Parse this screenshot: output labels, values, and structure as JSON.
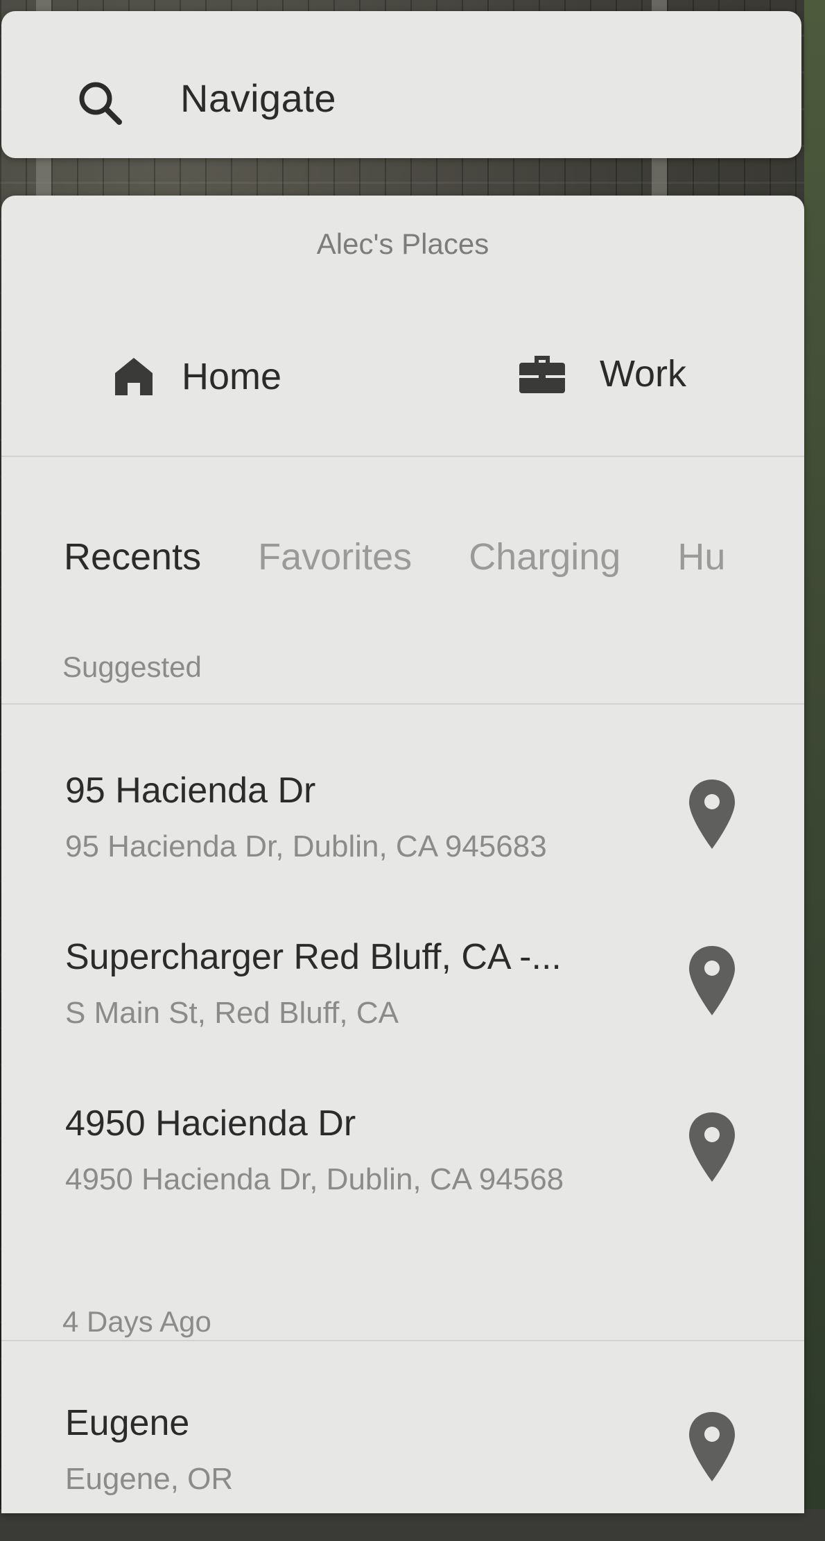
{
  "search": {
    "placeholder": "Navigate",
    "icon": "search-icon"
  },
  "places": {
    "title": "Alec's Places",
    "quick": [
      {
        "label": "Home",
        "icon": "home-icon"
      },
      {
        "label": "Work",
        "icon": "briefcase-icon"
      }
    ],
    "tabs": [
      "Recents",
      "Favorites",
      "Charging",
      "Hu"
    ],
    "active_tab": "Recents",
    "sections": [
      {
        "label": "Suggested",
        "items": [
          {
            "title": "95  Hacienda Dr",
            "subtitle": "95 Hacienda Dr, Dublin, CA 945683"
          },
          {
            "title": "Supercharger Red Bluff, CA -...",
            "subtitle": "S Main St, Red Bluff, CA"
          },
          {
            "title": "4950 Hacienda Dr",
            "subtitle": "4950 Hacienda Dr, Dublin, CA 94568"
          }
        ]
      },
      {
        "label": "4 Days Ago",
        "items": [
          {
            "title": "Eugene",
            "subtitle": "Eugene, OR"
          }
        ]
      }
    ]
  },
  "colors": {
    "panel": "#e7e7e5",
    "text_primary": "#2b2b2b",
    "text_secondary": "#8b8b89",
    "icon": "#5f5f5d"
  }
}
